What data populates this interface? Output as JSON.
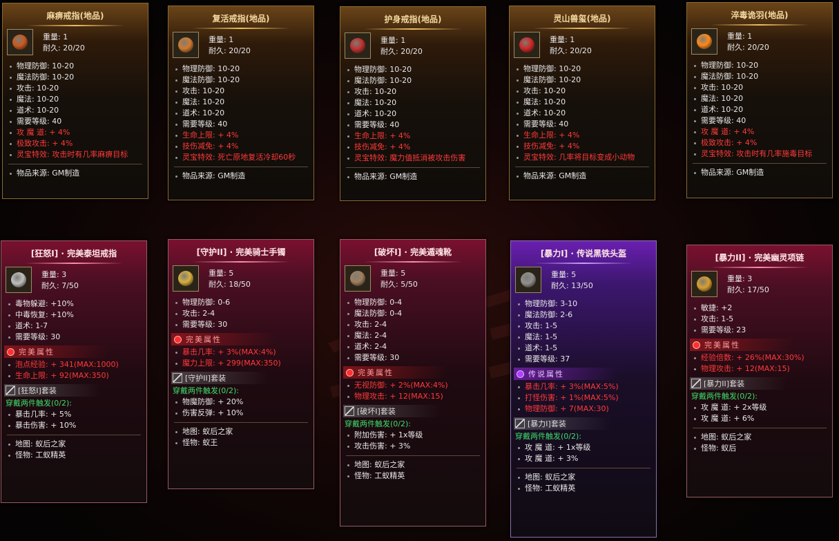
{
  "cards": [
    {
      "title": "麻痹戒指(地品)",
      "weight_label": "重量: 1",
      "durability_label": "耐久: 20/20",
      "icon": "ring-icon",
      "glyph_color": "#c85a20",
      "stats": [
        "物理防御: 10-20",
        "魔法防御: 10-20",
        "攻击: 10-20",
        "魔法: 10-20",
        "道术: 10-20",
        "需要等级: 40"
      ],
      "red": [
        "攻 魔 道: + 4%",
        "极致攻击: + 4%",
        "灵宝特效: 攻击时有几率麻痹目标"
      ],
      "source": "物品来源: GM制造"
    },
    {
      "title": "复活戒指(地品)",
      "weight_label": "重量: 1",
      "durability_label": "耐久: 20/20",
      "icon": "ring-icon",
      "glyph_color": "#d07a30",
      "stats": [
        "物理防御: 10-20",
        "魔法防御: 10-20",
        "攻击: 10-20",
        "魔法: 10-20",
        "道术: 10-20",
        "需要等级: 40"
      ],
      "red": [
        "生命上限: + 4%",
        "技伤减免: + 4%",
        "灵宝特效: 死亡原地复活冷却60秒"
      ],
      "source": "物品来源: GM制造"
    },
    {
      "title": "护身戒指(地品)",
      "weight_label": "重量: 1",
      "durability_label": "耐久: 20/20",
      "icon": "ring-icon",
      "glyph_color": "#c03030",
      "stats": [
        "物理防御: 10-20",
        "魔法防御: 10-20",
        "攻击: 10-20",
        "魔法: 10-20",
        "道术: 10-20",
        "需要等级: 40"
      ],
      "red": [
        "生命上限: + 4%",
        "技伤减免: + 4%",
        "灵宝特效: 魔力值抵消被攻击伤害"
      ],
      "source": "物品来源: GM制造"
    },
    {
      "title": "灵山兽玺(地品)",
      "weight_label": "重量: 1",
      "durability_label": "耐久: 20/20",
      "icon": "seal-icon",
      "glyph_color": "#d02828",
      "stats": [
        "物理防御: 10-20",
        "魔法防御: 10-20",
        "攻击: 10-20",
        "魔法: 10-20",
        "道术: 10-20",
        "需要等级: 40"
      ],
      "red": [
        "生命上限: + 4%",
        "技伤减免: + 4%",
        "灵宝特效: 几率将目标变成小动物"
      ],
      "source": "物品来源: GM制造"
    },
    {
      "title": "淬毒诡羽(地品)",
      "weight_label": "重量: 1",
      "durability_label": "耐久: 20/20",
      "icon": "feather-icon",
      "glyph_color": "#ff8a1a",
      "stats": [
        "物理防御: 10-20",
        "魔法防御: 10-20",
        "攻击: 10-20",
        "魔法: 10-20",
        "道术: 10-20",
        "需要等级: 40"
      ],
      "red": [
        "攻 魔 道: + 4%",
        "极致攻击: + 4%",
        "灵宝特效: 攻击时有几率施毒目标"
      ],
      "source": "物品来源: GM制造"
    },
    {
      "title": "[狂怒I] · 完美泰坦戒指",
      "weight_label": "重量: 3",
      "durability_label": "耐久: 7/50",
      "icon": "ring-icon",
      "glyph_color": "#c0c0c0",
      "stats": [
        "毒物躲避: +10%",
        "中毒恢复: +10%",
        "道术: 1-7",
        "需要等级: 30"
      ],
      "badge": "完美属性",
      "red": [
        "泡点经验: + 341(MAX:1000)",
        "生命上限: + 92(MAX:350)"
      ],
      "set": "[狂怒I]套装",
      "trigger": "穿戴两件触发(0/2):",
      "trigger_items": [
        "暴击几率: + 5%",
        "暴击伤害: + 10%"
      ],
      "map": "地图: 蚁后之家",
      "monster": "怪物: 工蚁精英"
    },
    {
      "title": "[守护II] · 完美骑士手镯",
      "weight_label": "重量: 5",
      "durability_label": "耐久: 18/50",
      "icon": "bracelet-icon",
      "glyph_color": "#d8b040",
      "stats": [
        "物理防御: 0-6",
        "攻击: 2-4",
        "需要等级: 30"
      ],
      "badge": "完美属性",
      "red": [
        "暴击几率: + 3%(MAX:4%)",
        "魔力上限: + 299(MAX:350)"
      ],
      "set": "[守护II]套装",
      "trigger": "穿戴两件触发(0/2):",
      "trigger_items": [
        "物魔防御: + 20%",
        "伤害反弹: + 10%"
      ],
      "map": "地图: 蚁后之家",
      "monster": "怪物: 蚁王"
    },
    {
      "title": "[破坏I] · 完美遁魂靴",
      "weight_label": "重量: 5",
      "durability_label": "耐久: 5/50",
      "icon": "boots-icon",
      "glyph_color": "#a08060",
      "stats": [
        "物理防御: 0-4",
        "魔法防御: 0-4",
        "攻击: 2-4",
        "魔法: 2-4",
        "道术: 2-4",
        "需要等级: 30"
      ],
      "badge": "完美属性",
      "red": [
        "无视防御: + 2%(MAX:4%)",
        "物理攻击: + 12(MAX:15)"
      ],
      "set": "[破坏I]套装",
      "trigger": "穿戴两件触发(0/2):",
      "trigger_items": [
        "附加伤害: + 1x等级",
        "攻击伤害: + 3%"
      ],
      "map": "地图: 蚁后之家",
      "monster": "怪物: 工蚁精英"
    },
    {
      "title": "[暴力I] · 传说黑铁头盔",
      "weight_label": "重量: 5",
      "durability_label": "耐久: 13/50",
      "icon": "helmet-icon",
      "glyph_color": "#909090",
      "stats": [
        "物理防御: 3-10",
        "魔法防御: 2-6",
        "攻击: 1-5",
        "魔法: 1-5",
        "道术: 1-5",
        "需要等级: 37"
      ],
      "badge": "传说属性",
      "badge_purple": true,
      "red": [
        "暴击几率: + 3%(MAX:5%)",
        "打怪伤害: + 1%(MAX:5%)",
        "物理防御: + 7(MAX:30)"
      ],
      "set": "[暴力I]套装",
      "trigger": "穿戴两件触发(0/2):",
      "trigger_items": [
        "攻 魔 道: + 1x等级",
        "攻 魔 道: + 3%"
      ],
      "map": "地图: 蚁后之家",
      "monster": "怪物: 工蚁精英"
    },
    {
      "title": "[暴力II] · 完美幽灵项链",
      "weight_label": "重量: 3",
      "durability_label": "耐久: 17/50",
      "icon": "necklace-icon",
      "glyph_color": "#d8a030",
      "stats": [
        "敏捷: +2",
        "攻击: 1-5",
        "需要等级: 23"
      ],
      "badge": "完美属性",
      "red": [
        "经验倍数: + 26%(MAX:30%)",
        "物理攻击: + 12(MAX:15)"
      ],
      "set": "[暴力II]套装",
      "trigger": "穿戴两件触发(0/2):",
      "trigger_items": [
        "攻 魔 道: + 2x等级",
        "攻 魔 道: + 6%"
      ],
      "map": "地图: 蚁后之家",
      "monster": "怪物: 蚁后"
    }
  ]
}
